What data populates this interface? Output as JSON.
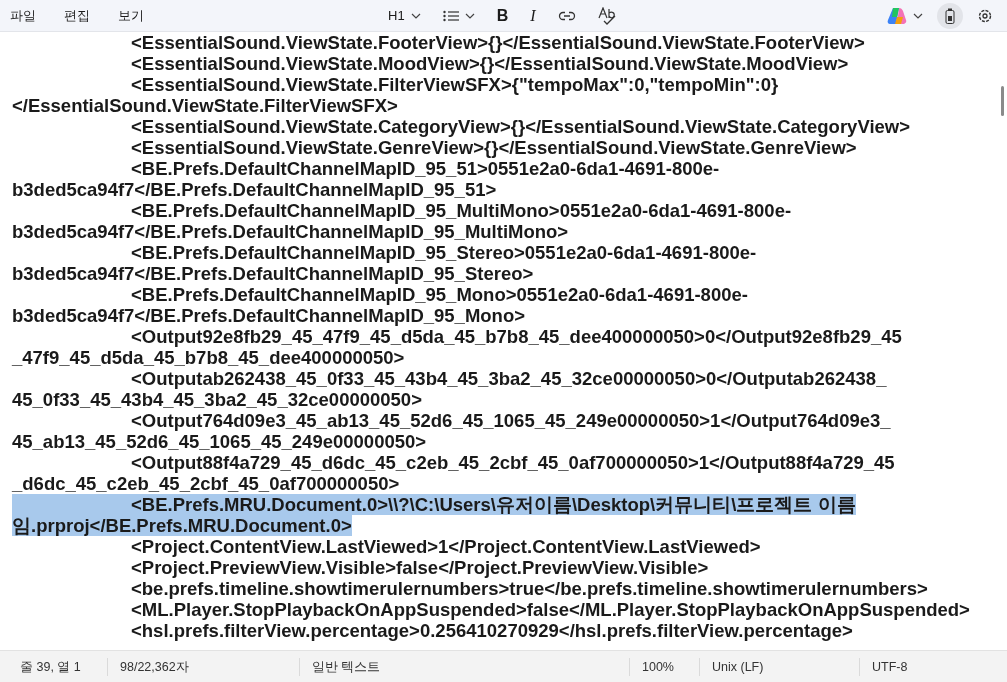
{
  "menu": [
    {
      "label": "파일"
    },
    {
      "label": "편집"
    },
    {
      "label": "보기"
    }
  ],
  "toolbar": [
    {
      "kind": "heading",
      "label": "H1"
    },
    {
      "kind": "list"
    },
    {
      "kind": "bold",
      "label": "B"
    },
    {
      "kind": "italic",
      "label": "I"
    },
    {
      "kind": "link"
    },
    {
      "kind": "spellcheck"
    }
  ],
  "editor": {
    "lines": [
      {
        "text": "\t\t<EssentialSound.ViewState.FooterView>{}</EssentialSound.ViewState.FooterView>",
        "selected": false
      },
      {
        "text": "\t\t<EssentialSound.ViewState.MoodView>{}</EssentialSound.ViewState.MoodView>",
        "selected": false
      },
      {
        "text": "\t\t<EssentialSound.ViewState.FilterViewSFX>{\"tempoMax\":0,\"tempoMin\":0}",
        "selected": false
      },
      {
        "text": "</EssentialSound.ViewState.FilterViewSFX>",
        "selected": false
      },
      {
        "text": "\t\t<EssentialSound.ViewState.CategoryView>{}</EssentialSound.ViewState.CategoryView>",
        "selected": false
      },
      {
        "text": "\t\t<EssentialSound.ViewState.GenreView>{}</EssentialSound.ViewState.GenreView>",
        "selected": false
      },
      {
        "text": "\t\t<BE.Prefs.DefaultChannelMapID_95_51>0551e2a0-6da1-4691-800e-",
        "selected": false
      },
      {
        "text": "b3ded5ca94f7</BE.Prefs.DefaultChannelMapID_95_51>",
        "selected": false
      },
      {
        "text": "\t\t<BE.Prefs.DefaultChannelMapID_95_MultiMono>0551e2a0-6da1-4691-800e-",
        "selected": false
      },
      {
        "text": "b3ded5ca94f7</BE.Prefs.DefaultChannelMapID_95_MultiMono>",
        "selected": false
      },
      {
        "text": "\t\t<BE.Prefs.DefaultChannelMapID_95_Stereo>0551e2a0-6da1-4691-800e-",
        "selected": false
      },
      {
        "text": "b3ded5ca94f7</BE.Prefs.DefaultChannelMapID_95_Stereo>",
        "selected": false
      },
      {
        "text": "\t\t<BE.Prefs.DefaultChannelMapID_95_Mono>0551e2a0-6da1-4691-800e-",
        "selected": false
      },
      {
        "text": "b3ded5ca94f7</BE.Prefs.DefaultChannelMapID_95_Mono>",
        "selected": false
      },
      {
        "text": "\t\t<Output92e8fb29_45_47f9_45_d5da_45_b7b8_45_dee400000050>0</Output92e8fb29_45",
        "selected": false
      },
      {
        "text": "_47f9_45_d5da_45_b7b8_45_dee400000050>",
        "selected": false
      },
      {
        "text": "\t\t<Outputab262438_45_0f33_45_43b4_45_3ba2_45_32ce00000050>0</Outputab262438_",
        "selected": false
      },
      {
        "text": "45_0f33_45_43b4_45_3ba2_45_32ce00000050>",
        "selected": false
      },
      {
        "text": "\t\t<Output764d09e3_45_ab13_45_52d6_45_1065_45_249e00000050>1</Output764d09e3_",
        "selected": false
      },
      {
        "text": "45_ab13_45_52d6_45_1065_45_249e00000050>",
        "selected": false
      },
      {
        "text": "\t\t<Output88f4a729_45_d6dc_45_c2eb_45_2cbf_45_0af700000050>1</Output88f4a729_45",
        "selected": false
      },
      {
        "text": "_d6dc_45_c2eb_45_2cbf_45_0af700000050>",
        "selected": false
      },
      {
        "text": "\t\t<BE.Prefs.MRU.Document.0>\\\\?\\C:\\Users\\유저이름\\Desktop\\커뮤니티\\프로젝트 이름",
        "selected": true
      },
      {
        "text": "임.prproj</BE.Prefs.MRU.Document.0>",
        "selected": true
      },
      {
        "text": "\t\t<Project.ContentView.LastViewed>1</Project.ContentView.LastViewed>",
        "selected": false
      },
      {
        "text": "\t\t<Project.PreviewView.Visible>false</Project.PreviewView.Visible>",
        "selected": false
      },
      {
        "text": "\t\t<be.prefs.timeline.showtimerulernumbers>true</be.prefs.timeline.showtimerulernumbers>",
        "selected": false
      },
      {
        "text": "\t\t<ML.Player.StopPlaybackOnAppSuspended>false</ML.Player.StopPlaybackOnAppSuspended>",
        "selected": false
      },
      {
        "text": "\t\t<hsl.prefs.filterView.percentage>0.256410270929</hsl.prefs.filterView.percentage>",
        "selected": false
      }
    ]
  },
  "status_bar": {
    "position": "줄 39, 열 1",
    "count": "98/22,362자",
    "format": "일반 텍스트",
    "zoom": "100%",
    "line_ending": "Unix (LF)",
    "encoding": "UTF-8"
  }
}
